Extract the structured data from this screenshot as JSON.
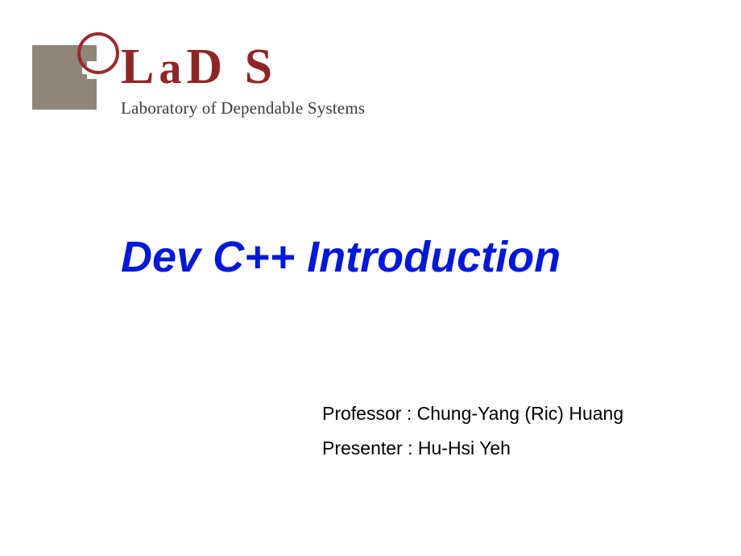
{
  "logo": {
    "brand_html_parts": [
      "L",
      "a",
      "D",
      "S"
    ],
    "subtitle": "Laboratory of Dependable Systems"
  },
  "title": "Dev C++ Introduction",
  "credits": {
    "professor": "Professor : Chung-Yang (Ric) Huang",
    "presenter": "Presenter : Hu-Hsi Yeh"
  }
}
